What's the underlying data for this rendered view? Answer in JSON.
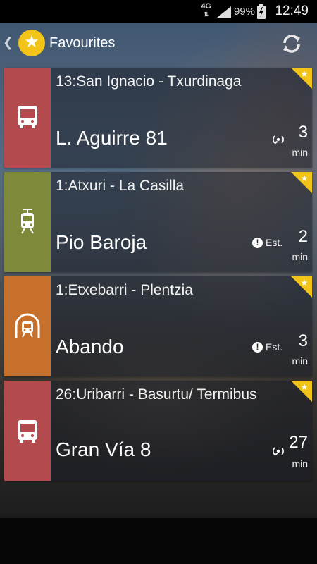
{
  "status_bar": {
    "network": "4G",
    "battery": "99%",
    "time": "12:49"
  },
  "header": {
    "title": "Favourites",
    "icons": [
      "chevron-left-icon",
      "star-icon",
      "refresh-icon"
    ]
  },
  "favourites": [
    {
      "mode": "bus",
      "route": "13:San Ignacio - Txurdinaga",
      "stop": "L. Aguirre 81",
      "time_type": "realtime",
      "minutes": "3",
      "unit": "min",
      "color": "#b34a4e"
    },
    {
      "mode": "tram",
      "route": "1:Atxuri - La Casilla",
      "stop": "Pio Baroja",
      "time_type": "estimated",
      "estimated_label": "Est.",
      "minutes": "2",
      "unit": "min",
      "color": "#7e8a3a"
    },
    {
      "mode": "metro",
      "route": "1:Etxebarri - Plentzia",
      "stop": "Abando",
      "time_type": "estimated",
      "estimated_label": "Est.",
      "minutes": "3",
      "unit": "min",
      "color": "#c6702b"
    },
    {
      "mode": "bus",
      "route": "26:Uribarri - Basurtu/ Termibus",
      "stop": "Gran Vía 8",
      "time_type": "realtime",
      "minutes": "27",
      "unit": "min",
      "color": "#b34a4e"
    }
  ],
  "colors": {
    "fav_corner": "#f2c417",
    "app_logo": "#f2c417"
  }
}
